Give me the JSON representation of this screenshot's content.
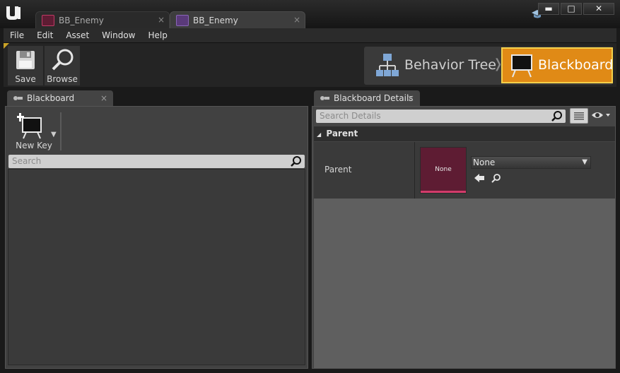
{
  "window": {
    "tabs": [
      {
        "label": "BB_Enemy",
        "close": "×"
      },
      {
        "label": "BB_Enemy",
        "close": "×"
      }
    ],
    "buttons": {
      "minimize": "▬",
      "maximize": "□",
      "close": "✕"
    }
  },
  "menu": [
    "File",
    "Edit",
    "Asset",
    "Window",
    "Help"
  ],
  "toolbar": {
    "save_label": "Save",
    "browse_label": "Browse",
    "mode_behavior_tree": "Behavior Tree",
    "mode_chevron": "❭",
    "mode_blackboard": "Blackboard"
  },
  "left_panel": {
    "tab_label": "Blackboard",
    "tab_close": "×",
    "new_key_label": "New Key",
    "search_placeholder": "Search"
  },
  "right_panel": {
    "tab_label": "Blackboard Details",
    "tab_close": "×",
    "search_placeholder": "Search Details",
    "category_label": "Parent",
    "category_arrow": "◢",
    "property_label": "Parent",
    "thumbnail_text": "None",
    "combo_value": "None"
  },
  "colors": {
    "accent_mode": "#e08a16",
    "accent_border": "#f4d04a",
    "thumbnail": "#5e1c33",
    "thumbnail_bar": "#d23b6a"
  }
}
